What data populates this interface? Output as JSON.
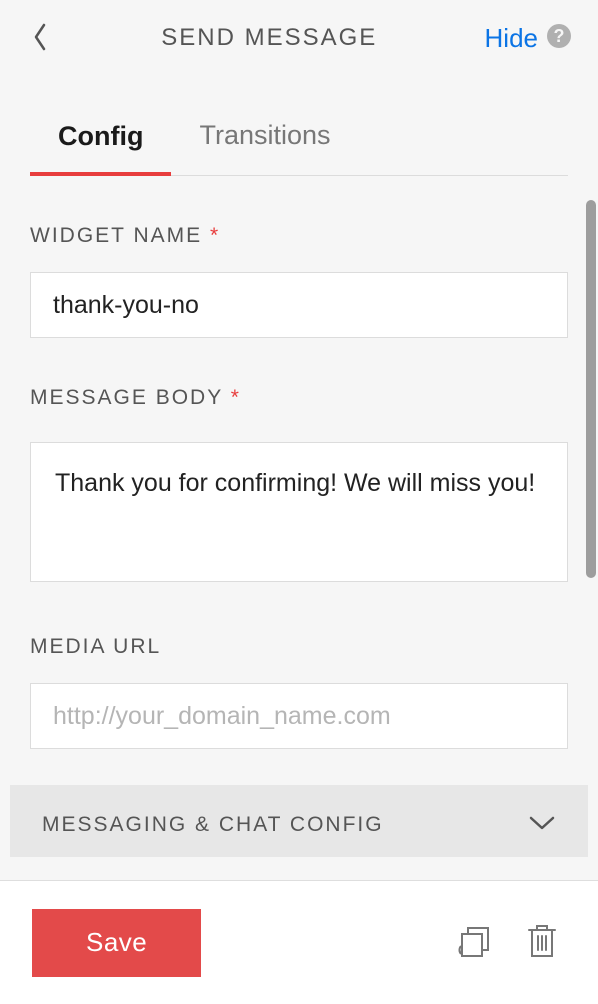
{
  "header": {
    "title": "SEND MESSAGE",
    "hide_label": "Hide"
  },
  "tabs": {
    "config": "Config",
    "transitions": "Transitions"
  },
  "form": {
    "widget_name_label": "WIDGET NAME",
    "widget_name_value": "thank-you-no",
    "message_body_label": "MESSAGE BODY",
    "message_body_value": "Thank you for confirming! We will miss you!",
    "media_url_label": "MEDIA URL",
    "media_url_placeholder": "http://your_domain_name.com"
  },
  "accordion": {
    "messaging_chat": "MESSAGING & CHAT CONFIG"
  },
  "footer": {
    "save_label": "Save"
  }
}
